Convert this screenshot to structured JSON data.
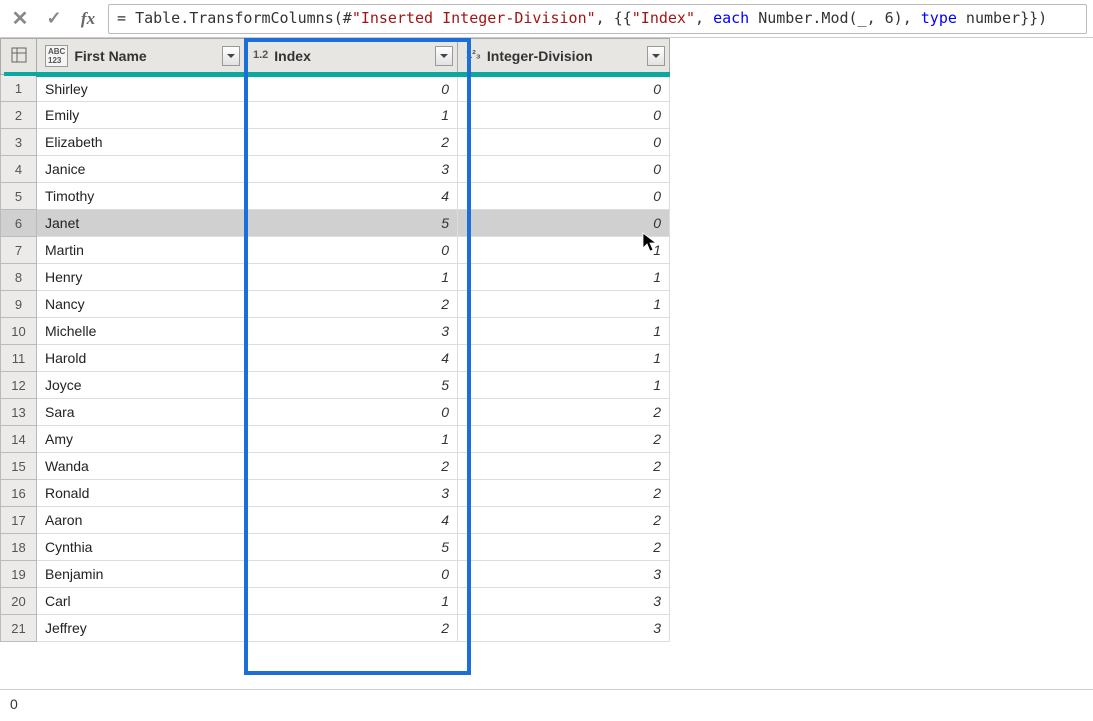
{
  "formula": {
    "eq": "= ",
    "p1": "Table.TransformColumns(#",
    "s1": "\"Inserted Integer-Division\"",
    "p2": ", {{",
    "s2": "\"Index\"",
    "p3": ", ",
    "k1": "each",
    "p4": " Number.Mod(_, 6), ",
    "k2": "type",
    "p5": " number}})"
  },
  "columns": {
    "first_name": {
      "label": "First Name",
      "type_label": "ABC\n123"
    },
    "index": {
      "label": "Index",
      "type_label": "1.2"
    },
    "integer_div": {
      "label": "Integer-Division",
      "type_label": "1²₃"
    }
  },
  "rows": [
    {
      "n": "1",
      "name": "Shirley",
      "idx": "0",
      "div": "0"
    },
    {
      "n": "2",
      "name": "Emily",
      "idx": "1",
      "div": "0"
    },
    {
      "n": "3",
      "name": "Elizabeth",
      "idx": "2",
      "div": "0"
    },
    {
      "n": "4",
      "name": "Janice",
      "idx": "3",
      "div": "0"
    },
    {
      "n": "5",
      "name": "Timothy",
      "idx": "4",
      "div": "0"
    },
    {
      "n": "6",
      "name": "Janet",
      "idx": "5",
      "div": "0"
    },
    {
      "n": "7",
      "name": "Martin",
      "idx": "0",
      "div": "1"
    },
    {
      "n": "8",
      "name": "Henry",
      "idx": "1",
      "div": "1"
    },
    {
      "n": "9",
      "name": "Nancy",
      "idx": "2",
      "div": "1"
    },
    {
      "n": "10",
      "name": "Michelle",
      "idx": "3",
      "div": "1"
    },
    {
      "n": "11",
      "name": "Harold",
      "idx": "4",
      "div": "1"
    },
    {
      "n": "12",
      "name": "Joyce",
      "idx": "5",
      "div": "1"
    },
    {
      "n": "13",
      "name": "Sara",
      "idx": "0",
      "div": "2"
    },
    {
      "n": "14",
      "name": "Amy",
      "idx": "1",
      "div": "2"
    },
    {
      "n": "15",
      "name": "Wanda",
      "idx": "2",
      "div": "2"
    },
    {
      "n": "16",
      "name": "Ronald",
      "idx": "3",
      "div": "2"
    },
    {
      "n": "17",
      "name": "Aaron",
      "idx": "4",
      "div": "2"
    },
    {
      "n": "18",
      "name": "Cynthia",
      "idx": "5",
      "div": "2"
    },
    {
      "n": "19",
      "name": "Benjamin",
      "idx": "0",
      "div": "3"
    },
    {
      "n": "20",
      "name": "Carl",
      "idx": "1",
      "div": "3"
    },
    {
      "n": "21",
      "name": "Jeffrey",
      "idx": "2",
      "div": "3"
    }
  ],
  "hovered_row_index": 5,
  "status": "0"
}
